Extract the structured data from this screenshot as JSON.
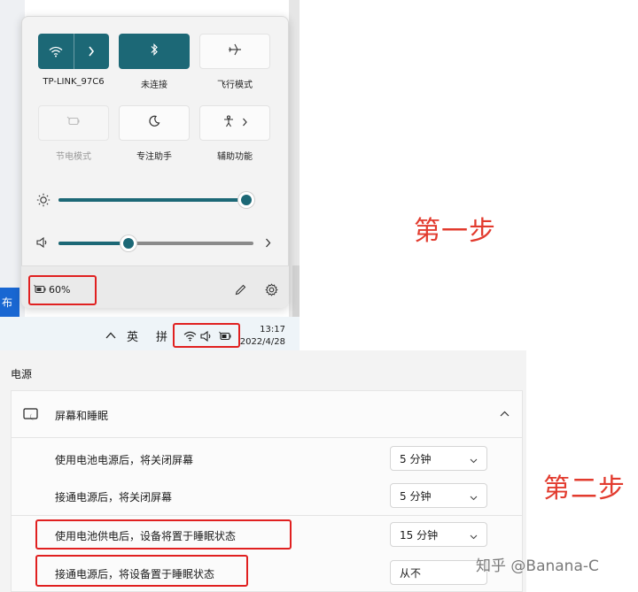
{
  "quick_settings": {
    "tiles": [
      {
        "label": "TP-LINK_97C6",
        "icon": "wifi-icon",
        "state": "on",
        "has_chevron": true
      },
      {
        "label": "未连接",
        "icon": "bluetooth-icon",
        "state": "on",
        "has_chevron": false
      },
      {
        "label": "飞行模式",
        "icon": "airplane-icon",
        "state": "off",
        "has_chevron": false
      },
      {
        "label": "节电模式",
        "icon": "battery-saver-icon",
        "state": "disabled",
        "has_chevron": false
      },
      {
        "label": "专注助手",
        "icon": "moon-icon",
        "state": "off",
        "has_chevron": false
      },
      {
        "label": "辅助功能",
        "icon": "accessibility-icon",
        "state": "off",
        "has_chevron": true
      }
    ],
    "brightness": {
      "icon": "sun-icon",
      "level_percent": 100
    },
    "volume": {
      "icon": "speaker-icon",
      "level_percent": 36
    },
    "battery": {
      "label": "60%",
      "icon": "battery-charging-icon"
    },
    "footer_icons": [
      "pencil-icon",
      "gear-icon"
    ]
  },
  "background_button": {
    "label": "布"
  },
  "taskbar": {
    "chevron_icon": "chevron-up-icon",
    "lang": "英",
    "ime": "拼",
    "tray_icons": [
      "wifi-icon",
      "speaker-icon",
      "battery-charging-icon"
    ],
    "time": "13:17",
    "date": "2022/4/28"
  },
  "steps": {
    "step1": "第一步",
    "step2": "第二步"
  },
  "settings": {
    "section_title": "电源",
    "group": {
      "title": "屏幕和睡眠",
      "icon": "screen-sleep-icon",
      "expand_icon": "chevron-up-icon"
    },
    "rows": [
      {
        "label": "使用电池电源后，将关闭屏幕",
        "value": "5 分钟"
      },
      {
        "label": "接通电源后，将关闭屏幕",
        "value": "5 分钟"
      },
      {
        "label": "使用电池供电后，设备将置于睡眠状态",
        "value": "15 分钟"
      },
      {
        "label": "接通电源后，将设备置于睡眠状态",
        "value": "从不"
      }
    ]
  },
  "watermark": "知乎 @Banana-C",
  "colors": {
    "accent": "#1c6876",
    "highlight": "#e02020",
    "step_text": "#e23b2e"
  }
}
